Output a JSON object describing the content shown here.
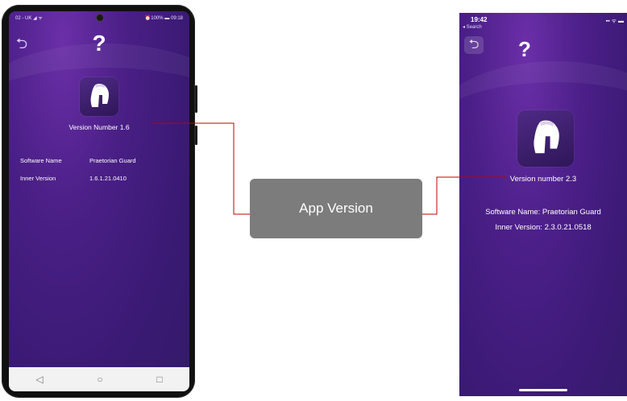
{
  "callout": {
    "label": "App Version"
  },
  "android": {
    "status_left": "02 - UK ◢ ᯤ",
    "status_right": "⏰100% ▬ 09:18",
    "help_glyph": "?",
    "version_text": "Version Number  1.6",
    "software_name_label": "Software Name",
    "software_name_value": "Praetorian Guard",
    "inner_version_label": "Inner Version",
    "inner_version_value": "1.6.1.21.0410",
    "nav": [
      "◁",
      "○",
      "□"
    ]
  },
  "iphone": {
    "time": "19:42",
    "back_link": "◂ Search",
    "status_right": "▪▪ ᯤ ▬",
    "help_glyph": "?",
    "version_text": "Version number 2.3",
    "software_name_line": "Software Name: Praetorian Guard",
    "inner_version_line": "Inner Version: 2.3.0.21.0518"
  },
  "colors": {
    "purple_bg": "#4a1f86",
    "connector": "#c00000",
    "callout_bg": "#7c7c7c"
  },
  "icons": [
    "back-arrow-icon",
    "question-icon",
    "spartan-helmet-icon",
    "android-nav-back-icon",
    "android-nav-home-icon",
    "android-nav-recent-icon"
  ]
}
